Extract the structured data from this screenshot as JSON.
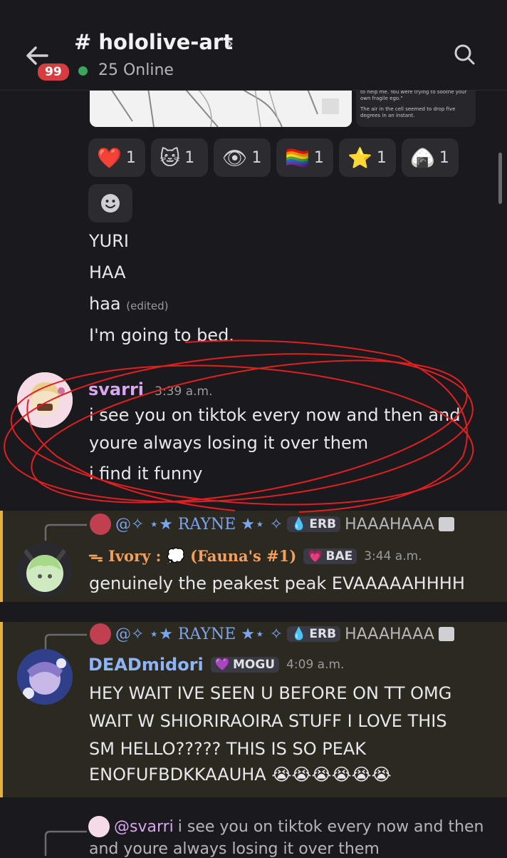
{
  "header": {
    "channel": "# hololive-art",
    "chevron": "›",
    "badge": "99",
    "online": "25 Online",
    "icons": [
      "back-arrow-icon",
      "search-icon"
    ]
  },
  "preview": {
    "text1": "sweet, foolish little cat. You weren't trying to help me. You were trying to soothe your own fragile ego.\"",
    "text2": "The air in the cell seemed to drop five degrees in an instant."
  },
  "reactions": [
    {
      "emoji": "❤️",
      "count": "1"
    },
    {
      "emoji": "🐱",
      "count": "1"
    },
    {
      "emoji": "👁",
      "count": "1"
    },
    {
      "emoji": "🏳️‍🌈",
      "count": "1"
    },
    {
      "emoji": "⭐",
      "count": "1"
    },
    {
      "emoji": "🍙",
      "count": "1"
    }
  ],
  "lines": {
    "l1": "YURI",
    "l2": "HAA",
    "l3": "haa",
    "l3_edited": "(edited)",
    "l4": "I'm going to bed."
  },
  "msg_svarri": {
    "author": "svarri",
    "time": "3:39 a.m.",
    "line1": "i see you on tiktok every now and then and",
    "line2": "youre always losing it over them",
    "line3": "i find it funny"
  },
  "msg_ivory": {
    "reply_name": "@✧ ⋆★ RAYNE ★⋆ ✧",
    "reply_tag": "ERB",
    "reply_text": "HAAAHAAA",
    "author": "ᯓ Ivory : 💭 (Fauna's #1)",
    "tag": "BAE",
    "time": "3:44 a.m.",
    "text": "genuinely the peakest peak EVAAAAAHHHH"
  },
  "msg_dead": {
    "reply_name": "@✧ ⋆★ RAYNE ★⋆ ✧",
    "reply_tag": "ERB",
    "reply_text": "HAAAHAAA",
    "author": "DEADmidori",
    "tag": "MOGU",
    "time": "4:09 a.m.",
    "line1": "HEY WAIT IVE SEEN U BEFORE ON TT OMG",
    "line2": "WAIT W SHIORIRAOIRA STUFF I LOVE THIS",
    "line3": "SM HELLO????? THIS IS SO PEAK",
    "line4": "ENOFUFBDKKAAUHA 😭😭😭😭😭😭"
  },
  "msg_last": {
    "reply_name": "@svarri",
    "reply_text": "i see you on tiktok every now and then",
    "reply_text2": "and youre always losing it over them"
  },
  "colors": {
    "background": "#1a1a1e",
    "highlight": "#2c2920",
    "highlight_bar": "#e6b13a",
    "svarri_name": "#d9a6f0",
    "ivory_name": "#f0a060",
    "dead_name": "#8fb4f5",
    "annotation": "#e02020"
  }
}
